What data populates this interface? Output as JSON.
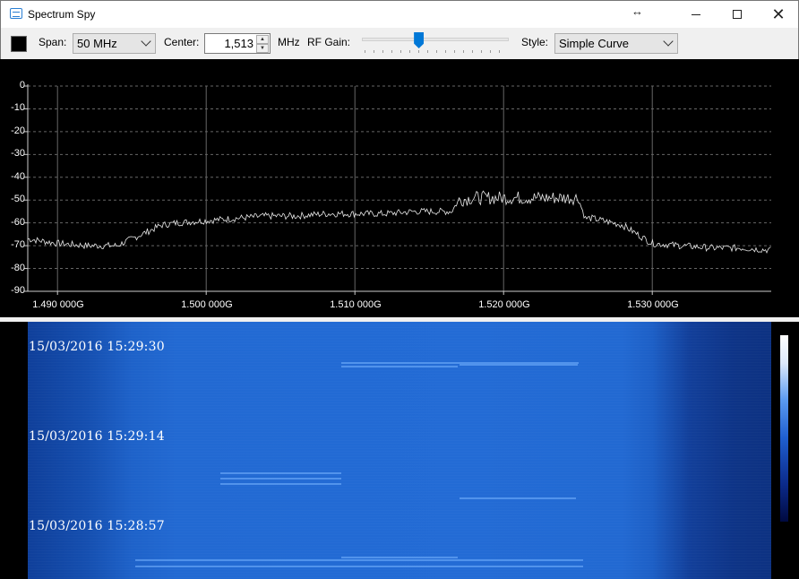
{
  "window": {
    "title": "Spectrum Spy"
  },
  "toolbar": {
    "span_label": "Span:",
    "span_value": "50 MHz",
    "center_label": "Center:",
    "center_value": "1,513",
    "center_unit": "MHz",
    "rf_gain_label": "RF Gain:",
    "rf_gain_level": 0.38,
    "style_label": "Style:",
    "style_value": "Simple Curve"
  },
  "chart_data": {
    "type": "line",
    "ylim": [
      -90,
      0
    ],
    "xlim": [
      1.488,
      1.538
    ],
    "y_ticks": [
      "0",
      "-10",
      "-20",
      "-30",
      "-40",
      "-50",
      "-60",
      "-70",
      "-80",
      "-90"
    ],
    "x_tick_values": [
      1.49,
      1.5,
      1.51,
      1.52,
      1.53
    ],
    "x_tick_labels": [
      "1.490 000G",
      "1.500 000G",
      "1.510 000G",
      "1.520 000G",
      "1.530 000G"
    ],
    "grid": true,
    "series": [
      {
        "x": [
          1.488,
          1.49,
          1.492,
          1.494,
          1.495,
          1.496,
          1.497,
          1.498,
          1.5,
          1.502,
          1.504,
          1.506,
          1.508,
          1.51,
          1.512,
          1.514,
          1.5165,
          1.517,
          1.518,
          1.52,
          1.522,
          1.524,
          1.525,
          1.5255,
          1.526,
          1.528,
          1.529,
          1.53,
          1.532,
          1.534,
          1.536,
          1.538
        ],
        "y": [
          -67,
          -69,
          -70,
          -70,
          -67,
          -64,
          -61,
          -60,
          -59,
          -58,
          -57,
          -57,
          -56,
          -56,
          -56,
          -55,
          -55,
          -50,
          -49,
          -49,
          -49,
          -49,
          -49,
          -58,
          -58,
          -61,
          -65,
          -69,
          -70,
          -71,
          -71,
          -72
        ]
      }
    ]
  },
  "waterfall": {
    "timestamps": [
      "15/03/2016 15:29:30",
      "15/03/2016 15:29:14",
      "15/03/2016 15:28:57"
    ]
  }
}
